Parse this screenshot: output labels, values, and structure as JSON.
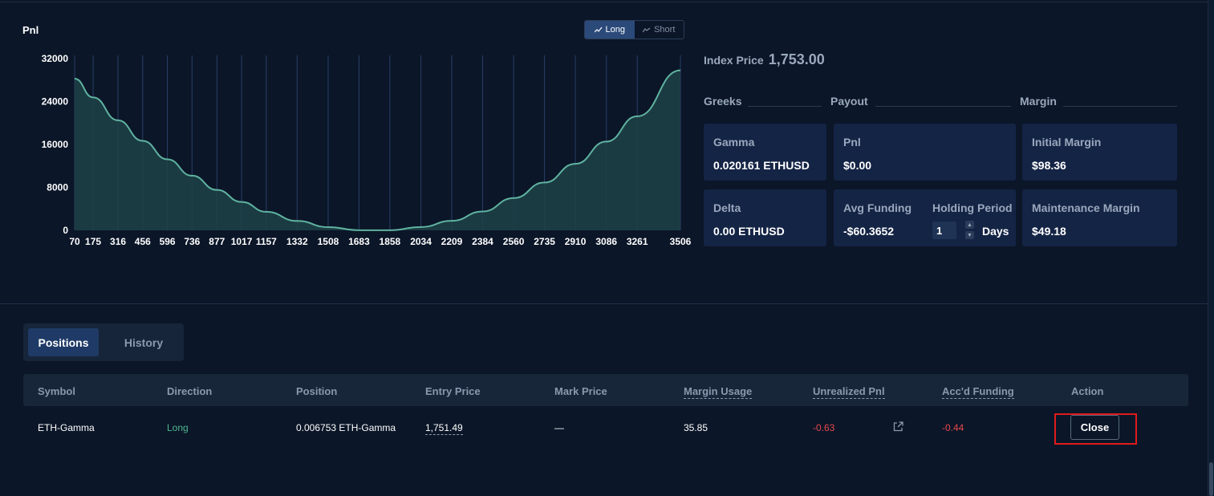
{
  "chart": {
    "title": "Pnl",
    "toggle": {
      "long_label": "Long",
      "short_label": "Short",
      "selected": "Long"
    }
  },
  "chart_data": {
    "type": "area",
    "title": "Pnl",
    "x": [
      70,
      175,
      316,
      456,
      596,
      736,
      877,
      1017,
      1157,
      1332,
      1508,
      1683,
      1858,
      2034,
      2209,
      2384,
      2560,
      2735,
      2910,
      3086,
      3261,
      3506
    ],
    "x_tick_labels": [
      "70",
      "175",
      "316",
      "456",
      "596",
      "736",
      "877",
      "1017",
      "1157",
      "1332",
      "1508",
      "1683",
      "1858",
      "2034",
      "2209",
      "2384",
      "2560",
      "2735",
      "2910",
      "3086",
      "3261",
      "3506"
    ],
    "series": [
      {
        "values": [
          28270,
          24770,
          20500,
          16670,
          13240,
          10180,
          7530,
          5290,
          3450,
          1750,
          600,
          25,
          28,
          615,
          1770,
          3510,
          6010,
          8910,
          12390,
          16540,
          21250,
          29820
        ]
      }
    ],
    "y_ticks": [
      0,
      8000,
      16000,
      24000,
      32000
    ],
    "ylim": [
      0,
      32000
    ],
    "grid": "vertical",
    "colors": {
      "line": "#5fb3a0",
      "fill": "#1f4248",
      "grid": "#2a3f68"
    }
  },
  "index_price": {
    "label": "Index Price",
    "value": "1,753.00"
  },
  "sections": {
    "greeks": "Greeks",
    "payout": "Payout",
    "margin": "Margin"
  },
  "cards": {
    "gamma": {
      "label": "Gamma",
      "value": "0.020161 ETHUSD"
    },
    "delta": {
      "label": "Delta",
      "value": "0.00 ETHUSD"
    },
    "pnl": {
      "label": "Pnl",
      "value": "$0.00"
    },
    "avg_funding": {
      "label": "Avg Funding",
      "value": "-$60.3652"
    },
    "holding_period": {
      "label": "Holding Period",
      "value": "1",
      "unit": "Days"
    },
    "initial_margin": {
      "label": "Initial Margin",
      "value": "$98.36"
    },
    "maintenance_margin": {
      "label": "Maintenance Margin",
      "value": "$49.18"
    }
  },
  "tabs": [
    {
      "label": "Positions",
      "active": true
    },
    {
      "label": "History",
      "active": false
    }
  ],
  "table": {
    "headers": [
      "Symbol",
      "Direction",
      "Position",
      "Entry Price",
      "Mark Price",
      "Margin Usage",
      "Unrealized Pnl",
      "Acc'd Funding",
      "Action"
    ],
    "rows": [
      {
        "symbol": "ETH-Gamma",
        "direction": "Long",
        "position": "0.006753 ETH-Gamma",
        "entry_price": "1,751.49",
        "mark_price": "—",
        "margin_usage": "35.85",
        "unrealized_pnl": "-0.63",
        "accd_funding": "-0.44",
        "action_label": "Close"
      }
    ]
  },
  "colors": {
    "background": "#0b1628",
    "card": "#142445",
    "positive": "#4fb68f",
    "negative": "#e5484d",
    "highlight": "#e01b1b"
  }
}
